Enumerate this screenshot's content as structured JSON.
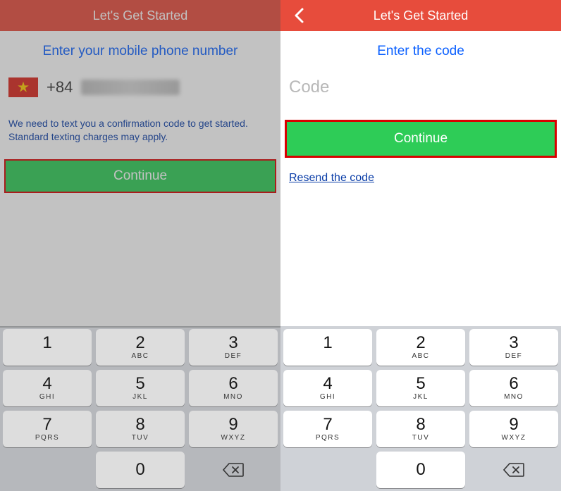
{
  "left": {
    "header_title": "Let's Get Started",
    "prompt": "Enter your mobile phone number",
    "dial_code": "+84",
    "helper": "We need to text you a confirmation code to get started. Standard texting charges may apply.",
    "continue_label": "Continue"
  },
  "right": {
    "header_title": "Let's Get Started",
    "prompt": "Enter the code",
    "code_placeholder": "Code",
    "continue_label": "Continue",
    "resend_label": "Resend the code"
  },
  "keypad": {
    "keys": [
      {
        "num": "1",
        "let": ""
      },
      {
        "num": "2",
        "let": "ABC"
      },
      {
        "num": "3",
        "let": "DEF"
      },
      {
        "num": "4",
        "let": "GHI"
      },
      {
        "num": "5",
        "let": "JKL"
      },
      {
        "num": "6",
        "let": "MNO"
      },
      {
        "num": "7",
        "let": "PQRS"
      },
      {
        "num": "8",
        "let": "TUV"
      },
      {
        "num": "9",
        "let": "WXYZ"
      },
      {
        "num": "0",
        "let": ""
      }
    ]
  }
}
